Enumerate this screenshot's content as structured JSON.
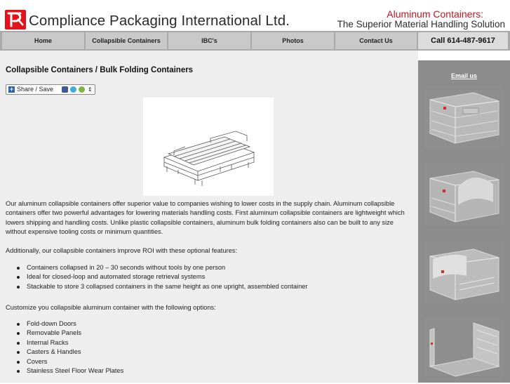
{
  "header": {
    "company": "Compliance Packaging International Ltd.",
    "tagline_line1": "Aluminum Containers:",
    "tagline_line2": "The Superior Material Handling Solution",
    "accent_color": "#e3121b"
  },
  "nav": {
    "items": [
      {
        "label": "Home"
      },
      {
        "label": "Collapsible Containers"
      },
      {
        "label": "IBC's"
      },
      {
        "label": "Photos"
      },
      {
        "label": "Contact Us"
      }
    ],
    "call": "Call 614-487-9617"
  },
  "main": {
    "title": "Collapsible Containers / Bulk Folding Containers",
    "share_label": "Share / Save",
    "intro": "Our aluminum collapsible containers offer superior value to companies wishing to lower costs in the supply chain. Aluminum collapsible containers offer two powerful advantages for lowering materials handling costs. First aluminum collapsible containers are lightweight which lowers shipping and handling costs. Unlike plastic collapsible containers, aluminum bulk folding containers also can be built to any size without expensive tooling costs or minimum quantities.",
    "features_intro": "Additionally, our collapsible containers improve ROI with these optional features:",
    "features": [
      "Containers collapsed in 20 – 30 seconds without tools by one person",
      "Ideal for closed-loop and automated storage retrieval systems",
      "Stackable to store 3 collapsed containers in the same height as one upright, assembled container"
    ],
    "options_intro": "Customize you collapsible aluminum container with the following options:",
    "options": [
      "Fold-down Doors",
      "Removable Panels",
      "Internal Racks",
      "Casters & Handles",
      "Covers",
      "Stainless Steel Floor Wear Plates"
    ]
  },
  "sidebar": {
    "email": "Email us"
  }
}
